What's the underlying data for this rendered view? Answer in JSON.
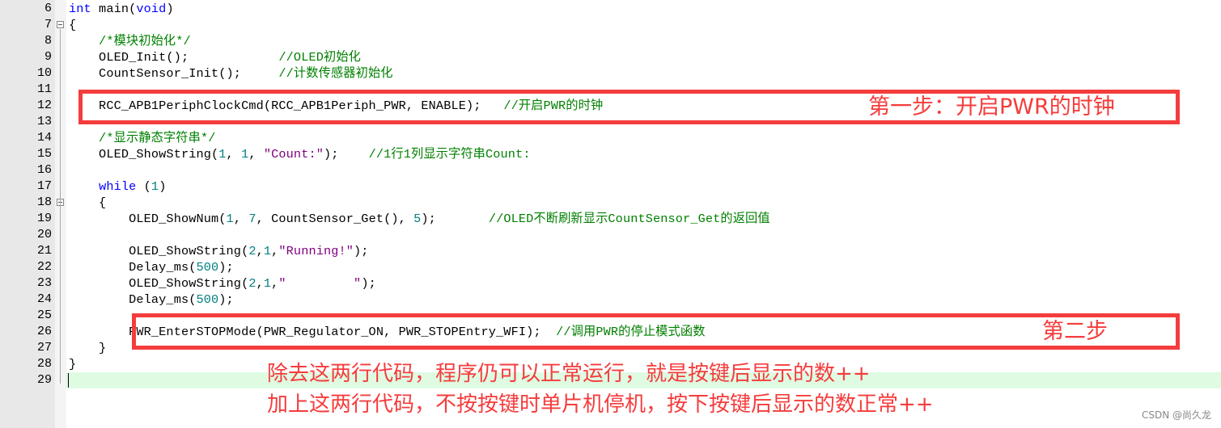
{
  "editor": {
    "lines": [
      {
        "n": "6",
        "parts": [
          {
            "t": "int",
            "c": "kw"
          },
          {
            "t": " main(",
            "c": ""
          },
          {
            "t": "void",
            "c": "kw"
          },
          {
            "t": ")",
            "c": ""
          }
        ]
      },
      {
        "n": "7",
        "fold": true,
        "parts": [
          {
            "t": "{",
            "c": ""
          }
        ]
      },
      {
        "n": "8",
        "parts": [
          {
            "t": "    /*模块初始化*/",
            "c": "cm"
          }
        ]
      },
      {
        "n": "9",
        "parts": [
          {
            "t": "    OLED_Init();            ",
            "c": ""
          },
          {
            "t": "//OLED初始化",
            "c": "cm"
          }
        ]
      },
      {
        "n": "10",
        "parts": [
          {
            "t": "    CountSensor_Init();     ",
            "c": ""
          },
          {
            "t": "//计数传感器初始化",
            "c": "cm"
          }
        ]
      },
      {
        "n": "11",
        "parts": []
      },
      {
        "n": "12",
        "parts": [
          {
            "t": "    RCC_APB1PeriphClockCmd(RCC_APB1Periph_PWR, ENABLE);   ",
            "c": ""
          },
          {
            "t": "//开启PWR的时钟",
            "c": "cm"
          }
        ]
      },
      {
        "n": "13",
        "parts": []
      },
      {
        "n": "14",
        "parts": [
          {
            "t": "    /*显示静态字符串*/",
            "c": "cm"
          }
        ]
      },
      {
        "n": "15",
        "parts": [
          {
            "t": "    OLED_ShowString(",
            "c": ""
          },
          {
            "t": "1",
            "c": "num"
          },
          {
            "t": ", ",
            "c": ""
          },
          {
            "t": "1",
            "c": "num"
          },
          {
            "t": ", ",
            "c": ""
          },
          {
            "t": "\"Count:\"",
            "c": "str"
          },
          {
            "t": ");    ",
            "c": ""
          },
          {
            "t": "//1行1列显示字符串Count:",
            "c": "cm"
          }
        ]
      },
      {
        "n": "16",
        "parts": []
      },
      {
        "n": "17",
        "parts": [
          {
            "t": "    ",
            "c": ""
          },
          {
            "t": "while",
            "c": "kw"
          },
          {
            "t": " (",
            "c": ""
          },
          {
            "t": "1",
            "c": "num"
          },
          {
            "t": ")",
            "c": ""
          }
        ]
      },
      {
        "n": "18",
        "fold": true,
        "parts": [
          {
            "t": "    {",
            "c": ""
          }
        ]
      },
      {
        "n": "19",
        "parts": [
          {
            "t": "        OLED_ShowNum(",
            "c": ""
          },
          {
            "t": "1",
            "c": "num"
          },
          {
            "t": ", ",
            "c": ""
          },
          {
            "t": "7",
            "c": "num"
          },
          {
            "t": ", CountSensor_Get(), ",
            "c": ""
          },
          {
            "t": "5",
            "c": "num"
          },
          {
            "t": ");       ",
            "c": ""
          },
          {
            "t": "//OLED不断刷新显示CountSensor_Get的返回值",
            "c": "cm"
          }
        ]
      },
      {
        "n": "20",
        "parts": []
      },
      {
        "n": "21",
        "parts": [
          {
            "t": "        OLED_ShowString(",
            "c": ""
          },
          {
            "t": "2",
            "c": "num"
          },
          {
            "t": ",",
            "c": ""
          },
          {
            "t": "1",
            "c": "num"
          },
          {
            "t": ",",
            "c": ""
          },
          {
            "t": "\"Running!\"",
            "c": "str"
          },
          {
            "t": ");",
            "c": ""
          }
        ]
      },
      {
        "n": "22",
        "parts": [
          {
            "t": "        Delay_ms(",
            "c": ""
          },
          {
            "t": "500",
            "c": "num"
          },
          {
            "t": ");",
            "c": ""
          }
        ]
      },
      {
        "n": "23",
        "parts": [
          {
            "t": "        OLED_ShowString(",
            "c": ""
          },
          {
            "t": "2",
            "c": "num"
          },
          {
            "t": ",",
            "c": ""
          },
          {
            "t": "1",
            "c": "num"
          },
          {
            "t": ",",
            "c": ""
          },
          {
            "t": "\"         \"",
            "c": "str"
          },
          {
            "t": ");",
            "c": ""
          }
        ]
      },
      {
        "n": "24",
        "parts": [
          {
            "t": "        Delay_ms(",
            "c": ""
          },
          {
            "t": "500",
            "c": "num"
          },
          {
            "t": ");",
            "c": ""
          }
        ]
      },
      {
        "n": "25",
        "parts": []
      },
      {
        "n": "26",
        "parts": [
          {
            "t": "        PWR_EnterSTOPMode(PWR_Regulator_ON, PWR_STOPEntry_WFI);  ",
            "c": ""
          },
          {
            "t": "//调用PWR的停止模式函数",
            "c": "cm"
          }
        ]
      },
      {
        "n": "27",
        "parts": [
          {
            "t": "    }",
            "c": ""
          }
        ]
      },
      {
        "n": "28",
        "parts": [
          {
            "t": "}",
            "c": ""
          }
        ]
      },
      {
        "n": "29",
        "current": true,
        "parts": []
      }
    ]
  },
  "annotations": {
    "step1": "第一步：开启PWR的时钟",
    "step2": "第二步",
    "note1": "除去这两行代码，程序仍可以正常运行，就是按键后显示的数++",
    "note2": "加上这两行代码，不按按键时单片机停机，按下按键后显示的数正常++"
  },
  "colors": {
    "annotation_red": "#f53c3c",
    "keyword": "#0000ff",
    "number": "#008080",
    "string": "#800080",
    "comment": "#008000",
    "current_line": "#dffbe2"
  },
  "watermark": "CSDN @尚久龙"
}
